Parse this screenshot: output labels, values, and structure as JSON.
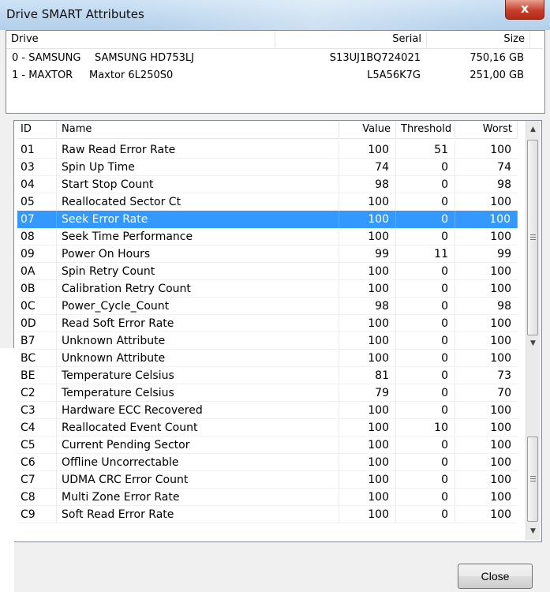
{
  "window": {
    "title": "Drive SMART Attributes",
    "close_glyph": "x"
  },
  "drives": {
    "headers": {
      "drive": "Drive",
      "serial": "Serial",
      "size": "Size"
    },
    "rows": [
      {
        "drive": "0 - SAMSUNG",
        "model": "SAMSUNG HD753LJ",
        "serial": "S13UJ1BQ724021",
        "size": "750,16 GB"
      },
      {
        "drive": "1 - MAXTOR",
        "model": "Maxtor 6L250S0",
        "serial": "L5A56K7G",
        "size": "251,00 GB"
      }
    ]
  },
  "smart": {
    "headers": {
      "id": "ID",
      "name": "Name",
      "value": "Value",
      "threshold": "Threshold",
      "worst": "Worst"
    },
    "selected_index": 4,
    "rows": [
      {
        "id": "01",
        "name": "Raw Read Error Rate",
        "value": "100",
        "threshold": "51",
        "worst": "100"
      },
      {
        "id": "03",
        "name": "Spin Up Time",
        "value": "74",
        "threshold": "0",
        "worst": "74"
      },
      {
        "id": "04",
        "name": "Start Stop Count",
        "value": "98",
        "threshold": "0",
        "worst": "98"
      },
      {
        "id": "05",
        "name": "Reallocated Sector Ct",
        "value": "100",
        "threshold": "0",
        "worst": "100"
      },
      {
        "id": "07",
        "name": "Seek Error Rate",
        "value": "100",
        "threshold": "0",
        "worst": "100"
      },
      {
        "id": "08",
        "name": "Seek Time Performance",
        "value": "100",
        "threshold": "0",
        "worst": "100"
      },
      {
        "id": "09",
        "name": "Power On Hours",
        "value": "99",
        "threshold": "11",
        "worst": "99"
      },
      {
        "id": "0A",
        "name": "Spin Retry Count",
        "value": "100",
        "threshold": "0",
        "worst": "100"
      },
      {
        "id": "0B",
        "name": "Calibration Retry Count",
        "value": "100",
        "threshold": "0",
        "worst": "100"
      },
      {
        "id": "0C",
        "name": "Power_Cycle_Count",
        "value": "98",
        "threshold": "0",
        "worst": "98"
      },
      {
        "id": "0D",
        "name": "Read Soft Error Rate",
        "value": "100",
        "threshold": "0",
        "worst": "100"
      },
      {
        "id": "B7",
        "name": "Unknown Attribute",
        "value": "100",
        "threshold": "0",
        "worst": "100"
      },
      {
        "id": "BC",
        "name": "Unknown Attribute",
        "value": "100",
        "threshold": "0",
        "worst": "100"
      },
      {
        "id": "BE",
        "name": "Temperature Celsius",
        "value": "81",
        "threshold": "0",
        "worst": "73"
      },
      {
        "id": "C2",
        "name": "Temperature Celsius",
        "value": "79",
        "threshold": "0",
        "worst": "70"
      },
      {
        "id": "C3",
        "name": "Hardware ECC Recovered",
        "value": "100",
        "threshold": "0",
        "worst": "100"
      },
      {
        "id": "C4",
        "name": "Reallocated Event Count",
        "value": "100",
        "threshold": "10",
        "worst": "100"
      },
      {
        "id": "C5",
        "name": "Current Pending Sector",
        "value": "100",
        "threshold": "0",
        "worst": "100"
      },
      {
        "id": "C6",
        "name": "Offline Uncorrectable",
        "value": "100",
        "threshold": "0",
        "worst": "100"
      },
      {
        "id": "C7",
        "name": "UDMA CRC Error Count",
        "value": "100",
        "threshold": "0",
        "worst": "100"
      },
      {
        "id": "C8",
        "name": "Multi Zone Error Rate",
        "value": "100",
        "threshold": "0",
        "worst": "100"
      },
      {
        "id": "C9",
        "name": "Soft Read Error Rate",
        "value": "100",
        "threshold": "0",
        "worst": "100"
      }
    ]
  },
  "buttons": {
    "close": "Close"
  },
  "scrollbar": {
    "up_glyph": "▲",
    "down_glyph": "▼"
  }
}
